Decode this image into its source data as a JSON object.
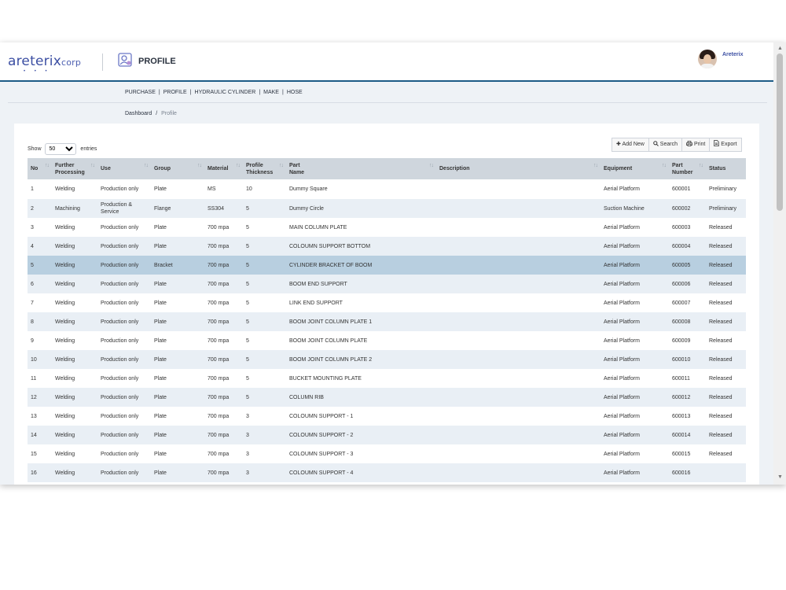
{
  "app": {
    "logo_text": "areterix",
    "logo_suffix": "corp",
    "logo_dots": "• • •",
    "page_title": "PROFILE",
    "user_name": "Areterix"
  },
  "nav": [
    "PURCHASE",
    "PROFILE",
    "HYDRAULIC CYLINDER",
    "MAKE",
    "HOSE"
  ],
  "nav_separator": "|",
  "breadcrumb": {
    "home": "Dashboard",
    "separator": "/",
    "current": "Profile"
  },
  "controls": {
    "show_label": "Show",
    "entries_value": "50",
    "entries_label": "entries",
    "add_new": "Add New",
    "search": "Search",
    "print": "Print",
    "export": "Export"
  },
  "table": {
    "columns": [
      "No",
      "Further Processing",
      "Use",
      "Group",
      "Material",
      "Profile Thickness",
      "Part Name",
      "Description",
      "Equipment",
      "Part Number",
      "Status"
    ],
    "selected_row": 5,
    "rows": [
      [
        "1",
        "Welding",
        "Production only",
        "Plate",
        "MS",
        "10",
        "Dummy Square",
        "",
        "Aerial Platform",
        "600001",
        "Preliminary"
      ],
      [
        "2",
        "Machining",
        "Production & Service",
        "Flange",
        "SS304",
        "5",
        "Dummy Circle",
        "",
        "Suction Machine",
        "600002",
        "Preliminary"
      ],
      [
        "3",
        "Welding",
        "Production only",
        "Plate",
        "700 mpa",
        "5",
        "MAIN COLUMN PLATE",
        "",
        "Aerial Platform",
        "600003",
        "Released"
      ],
      [
        "4",
        "Welding",
        "Production only",
        "Plate",
        "700 mpa",
        "5",
        "COLOUMN SUPPORT BOTTOM",
        "",
        "Aerial Platform",
        "600004",
        "Released"
      ],
      [
        "5",
        "Welding",
        "Production only",
        "Bracket",
        "700 mpa",
        "5",
        "CYLINDER BRACKET OF BOOM",
        "",
        "Aerial Platform",
        "600005",
        "Released"
      ],
      [
        "6",
        "Welding",
        "Production only",
        "Plate",
        "700 mpa",
        "5",
        "BOOM END SUPPORT",
        "",
        "Aerial Platform",
        "600006",
        "Released"
      ],
      [
        "7",
        "Welding",
        "Production only",
        "Plate",
        "700 mpa",
        "5",
        "LINK END SUPPORT",
        "",
        "Aerial Platform",
        "600007",
        "Released"
      ],
      [
        "8",
        "Welding",
        "Production only",
        "Plate",
        "700 mpa",
        "5",
        "BOOM JOINT COLUMN PLATE 1",
        "",
        "Aerial Platform",
        "600008",
        "Released"
      ],
      [
        "9",
        "Welding",
        "Production only",
        "Plate",
        "700 mpa",
        "5",
        "BOOM JOINT COLUMN PLATE",
        "",
        "Aerial Platform",
        "600009",
        "Released"
      ],
      [
        "10",
        "Welding",
        "Production only",
        "Plate",
        "700 mpa",
        "5",
        "BOOM JOINT COLUMN PLATE 2",
        "",
        "Aerial Platform",
        "600010",
        "Released"
      ],
      [
        "11",
        "Welding",
        "Production only",
        "Plate",
        "700 mpa",
        "5",
        "BUCKET MOUNTING PLATE",
        "",
        "Aerial Platform",
        "600011",
        "Released"
      ],
      [
        "12",
        "Welding",
        "Production only",
        "Plate",
        "700 mpa",
        "5",
        "COLUMN RIB",
        "",
        "Aerial Platform",
        "600012",
        "Released"
      ],
      [
        "13",
        "Welding",
        "Production only",
        "Plate",
        "700 mpa",
        "3",
        "COLOUMN SUPPORT - 1",
        "",
        "Aerial Platform",
        "600013",
        "Released"
      ],
      [
        "14",
        "Welding",
        "Production only",
        "Plate",
        "700 mpa",
        "3",
        "COLOUMN SUPPORT - 2",
        "",
        "Aerial Platform",
        "600014",
        "Released"
      ],
      [
        "15",
        "Welding",
        "Production only",
        "Plate",
        "700 mpa",
        "3",
        "COLOUMN SUPPORT - 3",
        "",
        "Aerial Platform",
        "600015",
        "Released"
      ],
      [
        "16",
        "Welding",
        "Production only",
        "Plate",
        "700 mpa",
        "3",
        "COLOUMN SUPPORT - 4",
        "",
        "Aerial Platform",
        "600016",
        ""
      ]
    ]
  },
  "colors": {
    "header_rule": "#1c5b86",
    "brand": "#3c4fa3",
    "table_head": "#cfd6dd",
    "row_alt": "#e9eff5",
    "row_selected": "#b8cfe0"
  },
  "icons": {
    "add": "plus-icon",
    "search": "search-icon",
    "print": "print-icon",
    "export": "export-icon",
    "sort": "sort-icon",
    "profile": "profile-icon"
  }
}
